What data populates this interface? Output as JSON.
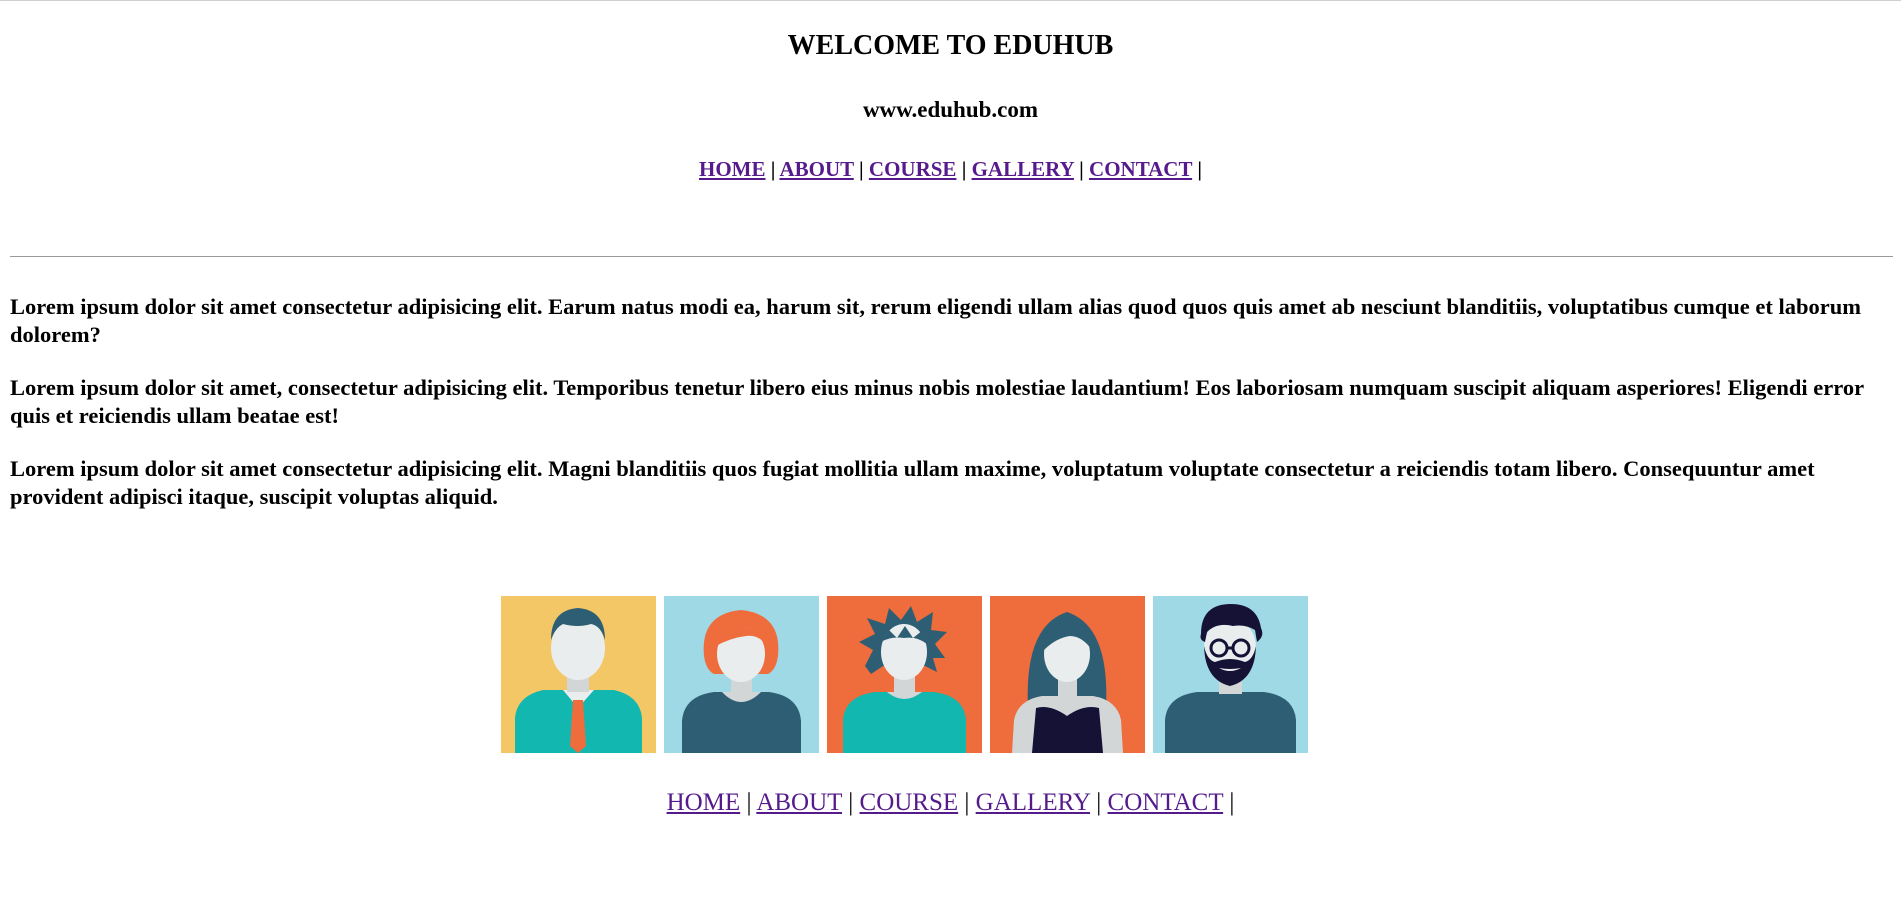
{
  "header": {
    "title": "WELCOME TO EDUHUB",
    "url": "www.eduhub.com"
  },
  "nav": {
    "items": [
      {
        "label": "HOME"
      },
      {
        "label": "ABOUT"
      },
      {
        "label": "COURSE"
      },
      {
        "label": "GALLERY"
      },
      {
        "label": "CONTACT"
      }
    ],
    "separator": "|"
  },
  "content": {
    "paragraphs": [
      "Lorem ipsum dolor sit amet consectetur adipisicing elit. Earum natus modi ea, harum sit, rerum eligendi ullam alias quod quos quis amet ab nesciunt blanditiis, voluptatibus cumque et laborum dolorem?",
      "Lorem ipsum dolor sit amet, consectetur adipisicing elit. Temporibus tenetur libero eius minus nobis molestiae laudantium! Eos laboriosam numquam suscipit aliquam asperiores! Eligendi error quis et reiciendis ullam beatae est!",
      "Lorem ipsum dolor sit amet consectetur adipisicing elit. Magni blanditiis quos fugiat mollitia ullam maxime, voluptatum voluptate consectetur a reiciendis totam libero. Consequuntur amet provident adipisci itaque, suscipit voluptas aliquid."
    ]
  },
  "gallery": {
    "tiles": [
      {
        "icon": "man-with-tie-avatar-icon",
        "background": "#f3c766"
      },
      {
        "icon": "red-haired-woman-avatar-icon",
        "background": "#9ed9e5"
      },
      {
        "icon": "spiky-haired-person-avatar-icon",
        "background": "#ef6c3c"
      },
      {
        "icon": "long-haired-woman-avatar-icon",
        "background": "#ef6c3c"
      },
      {
        "icon": "bearded-man-with-glasses-avatar-icon",
        "background": "#9ed9e5"
      }
    ]
  },
  "colors": {
    "link": "#551a8b",
    "divider": "#9a9a9a"
  }
}
